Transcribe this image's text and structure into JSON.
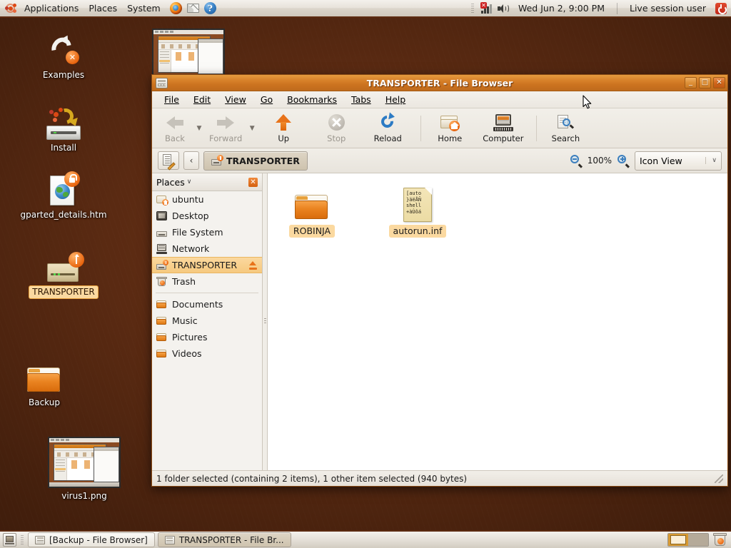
{
  "top_panel": {
    "logo_icon": "ubuntu-logo",
    "menus": [
      "Applications",
      "Places",
      "System"
    ],
    "launchers": [
      {
        "name": "firefox-icon",
        "title": "Firefox Web Browser"
      },
      {
        "name": "mail-icon",
        "title": "Evolution Mail"
      },
      {
        "name": "help-icon",
        "title": "Help"
      }
    ],
    "network_icon": "network-disconnected-icon",
    "volume_icon": "volume-icon",
    "clock": "Wed Jun  2,  9:00 PM",
    "user": "Live session user",
    "power_icon": "power-icon"
  },
  "desktop": {
    "icons": [
      {
        "label": "Examples",
        "icon": "link-arrow-icon",
        "selected": false
      },
      {
        "label": "Install",
        "icon": "install-cd-icon",
        "selected": false
      },
      {
        "label": "gparted_details.htm",
        "icon": "html-document-locked-icon",
        "selected": false
      },
      {
        "label": "TRANSPORTER",
        "icon": "usb-drive-icon",
        "selected": true
      },
      {
        "label": "Backup",
        "icon": "folder-icon",
        "selected": false
      },
      {
        "label": "virus1.png",
        "icon": "image-thumbnail-icon",
        "selected": false
      },
      {
        "label": "",
        "icon": "image-thumbnail-icon",
        "selected": false
      }
    ]
  },
  "window": {
    "title": "TRANSPORTER - File Browser",
    "titlebar_icon": "file-browser-icon",
    "buttons": {
      "minimize": "_",
      "maximize": "□",
      "close": "✕"
    },
    "menubar": [
      "File",
      "Edit",
      "View",
      "Go",
      "Bookmarks",
      "Tabs",
      "Help"
    ],
    "toolbar": [
      {
        "label": "Back",
        "icon": "arrow-left-icon",
        "disabled": true,
        "has_dropdown": true
      },
      {
        "label": "Forward",
        "icon": "arrow-right-icon",
        "disabled": true,
        "has_dropdown": true
      },
      {
        "label": "Up",
        "icon": "arrow-up-icon",
        "disabled": false,
        "has_dropdown": false
      },
      {
        "label": "Stop",
        "icon": "stop-icon",
        "disabled": true,
        "has_dropdown": false
      },
      {
        "label": "Reload",
        "icon": "reload-icon",
        "disabled": false,
        "has_dropdown": false
      },
      {
        "label": "Home",
        "icon": "home-folder-icon",
        "disabled": false,
        "has_dropdown": false
      },
      {
        "label": "Computer",
        "icon": "computer-icon",
        "disabled": false,
        "has_dropdown": false
      },
      {
        "label": "Search",
        "icon": "search-icon",
        "disabled": false,
        "has_dropdown": false
      }
    ],
    "location_bar": {
      "toggle_icon": "edit-location-icon",
      "back_chevron": "‹",
      "breadcrumb": "TRANSPORTER",
      "breadcrumb_icon": "usb-drive-small-icon",
      "zoom_out_icon": "zoom-out-icon",
      "zoom_level": "100%",
      "zoom_in_icon": "zoom-in-icon",
      "view_mode": "Icon View",
      "view_chevron": "∨"
    },
    "sidebar": {
      "header": "Places",
      "header_chevron": "∨",
      "close_icon": "close-icon",
      "groups": [
        [
          {
            "label": "ubuntu",
            "icon": "home-folder-icon",
            "active": false,
            "eject": false
          },
          {
            "label": "Desktop",
            "icon": "desktop-icon",
            "active": false,
            "eject": false
          },
          {
            "label": "File System",
            "icon": "filesystem-icon",
            "active": false,
            "eject": false
          },
          {
            "label": "Network",
            "icon": "network-icon",
            "active": false,
            "eject": false
          },
          {
            "label": "TRANSPORTER",
            "icon": "usb-drive-icon",
            "active": true,
            "eject": true
          },
          {
            "label": "Trash",
            "icon": "trash-icon",
            "active": false,
            "eject": false
          }
        ],
        [
          {
            "label": "Documents",
            "icon": "folder-icon",
            "active": false,
            "eject": false
          },
          {
            "label": "Music",
            "icon": "folder-icon",
            "active": false,
            "eject": false
          },
          {
            "label": "Pictures",
            "icon": "folder-icon",
            "active": false,
            "eject": false
          },
          {
            "label": "Videos",
            "icon": "folder-icon",
            "active": false,
            "eject": false
          }
        ]
      ]
    },
    "files": [
      {
        "name": "ROBINJA",
        "type": "folder",
        "icon": "folder-icon",
        "selected": true,
        "preview": ""
      },
      {
        "name": "autorun.inf",
        "type": "file",
        "icon": "text-file-icon",
        "selected": true,
        "preview": "[auto\n}äëÅÑ\nshell\n+àÙôá"
      }
    ],
    "status": "1 folder selected (containing 2 items), 1 other item selected (940 bytes)"
  },
  "bottom_panel": {
    "show_desktop_icon": "show-desktop-icon",
    "tasks": [
      {
        "label": "[Backup - File Browser]",
        "icon": "file-browser-icon",
        "active": false
      },
      {
        "label": "TRANSPORTER - File Br...",
        "icon": "file-browser-icon",
        "active": true
      }
    ],
    "workspaces": [
      {
        "name": "workspace-1",
        "active": true
      },
      {
        "name": "workspace-2",
        "active": false
      }
    ],
    "trash_icon": "trash-icon"
  },
  "colors": {
    "accent_orange": "#dd4814",
    "titlebar_orange": "#d8812a",
    "selection_yellow": "#fbd9a0",
    "desktop_brown": "#5a2a12",
    "panel_grey": "#e7e2da"
  }
}
